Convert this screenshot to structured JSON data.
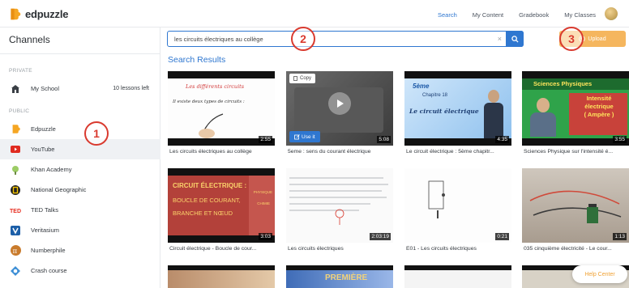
{
  "app": {
    "name": "edpuzzle"
  },
  "nav": {
    "search": "Search",
    "my_content": "My Content",
    "gradebook": "Gradebook",
    "my_classes": "My Classes"
  },
  "sidebar": {
    "title": "Channels",
    "private_label": "PRIVATE",
    "public_label": "PUBLIC",
    "private_items": [
      {
        "label": "My School",
        "count": "10 lessons left",
        "icon": "school-icon"
      }
    ],
    "public_items": [
      {
        "label": "Edpuzzle",
        "icon": "edpuzzle-icon"
      },
      {
        "label": "YouTube",
        "icon": "youtube-icon"
      },
      {
        "label": "Khan Academy",
        "icon": "khan-academy-icon"
      },
      {
        "label": "National Geographic",
        "icon": "nat-geo-icon"
      },
      {
        "label": "TED Talks",
        "icon": "ted-icon"
      },
      {
        "label": "Veritasium",
        "icon": "veritasium-icon"
      },
      {
        "label": "Numberphile",
        "icon": "numberphile-icon"
      },
      {
        "label": "Crash course",
        "icon": "crash-course-icon"
      }
    ]
  },
  "search": {
    "value": "les circuits électriques au collège",
    "clear": "×"
  },
  "upload": {
    "label": "Upload"
  },
  "results": {
    "title": "Search Results",
    "copy_label": "Copy",
    "use_label": "Use it",
    "videos": [
      {
        "caption": "Les circuits électriques au collège",
        "duration": "2:55",
        "thumb_text": [
          "Les différents circuits",
          "Il existe deux types de circuits :"
        ]
      },
      {
        "caption": "5eme : sens du courant électrique",
        "duration": "5:08"
      },
      {
        "caption": "Le circuit électrique : 5ème chapitr...",
        "duration": "4:35",
        "thumb_text": [
          "5ème",
          "Chapitre 18",
          "Le circuit électrique"
        ]
      },
      {
        "caption": "Sciences Physique sur l'intensité é...",
        "duration": "3:55",
        "thumb_text": [
          "Sciences Physiques",
          "Intensité",
          "électrique",
          "( Ampère )"
        ]
      },
      {
        "caption": "Circuit électrique - Boucle de cour...",
        "duration": "3:03",
        "thumb_text": [
          "CIRCUIT ÉLECTRIQUE :",
          "BOUCLE DE COURANT,",
          "BRANCHE ET NŒUD",
          "PHYSIQUE",
          "CHIMIE"
        ]
      },
      {
        "caption": "Les circuits électriques",
        "duration": "2:03:19"
      },
      {
        "caption": "E01 - Les circuits électriques",
        "duration": "0:21"
      },
      {
        "caption": "035 cinquième électricité - Le cour...",
        "duration": "1:13"
      }
    ],
    "row3_thumb_text": [
      "PREMIÈRE"
    ]
  },
  "help": {
    "label": "Help Center"
  },
  "annotations": [
    "1",
    "2",
    "3"
  ],
  "colors": {
    "accent": "#2f77d0",
    "upload": "#f5b65e",
    "annotation": "#d93a2f"
  }
}
